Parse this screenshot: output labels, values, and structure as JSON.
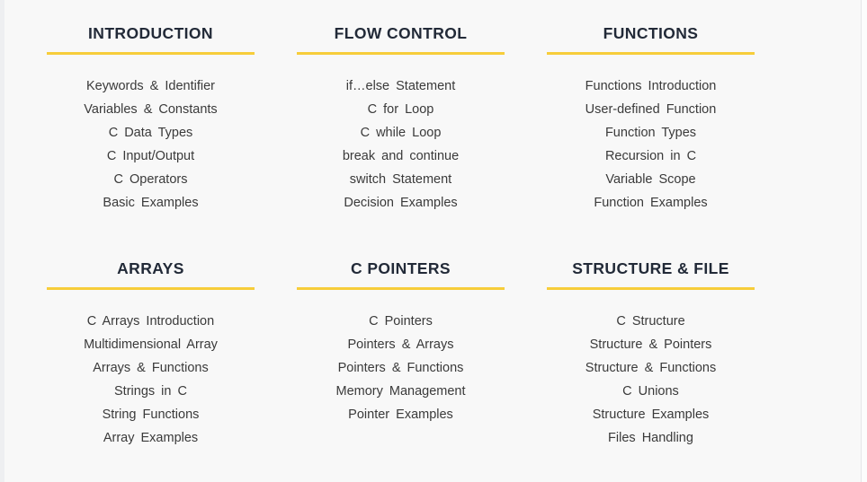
{
  "theme": {
    "page_background": "#f8f8f8",
    "accent_rule": "#f7cd3a",
    "heading_color": "#222a38",
    "link_color": "#3a3a3a"
  },
  "sections": [
    {
      "title": "INTRODUCTION",
      "links": [
        "Keywords & Identifier",
        "Variables & Constants",
        "C Data Types",
        "C Input/Output",
        "C Operators",
        "Basic Examples"
      ]
    },
    {
      "title": "FLOW CONTROL",
      "links": [
        "if…else Statement",
        "C for Loop",
        "C while Loop",
        "break and continue",
        "switch Statement",
        "Decision Examples"
      ]
    },
    {
      "title": "FUNCTIONS",
      "links": [
        "Functions Introduction",
        "User-defined Function",
        "Function Types",
        "Recursion in C",
        "Variable Scope",
        "Function Examples"
      ]
    },
    {
      "title": "ARRAYS",
      "links": [
        "C Arrays Introduction",
        "Multidimensional Array",
        "Arrays & Functions",
        "Strings in C",
        "String Functions",
        "Array Examples"
      ]
    },
    {
      "title": "C POINTERS",
      "links": [
        "C Pointers",
        "Pointers & Arrays",
        "Pointers & Functions",
        "Memory Management",
        "Pointer Examples"
      ]
    },
    {
      "title": "STRUCTURE & FILE",
      "links": [
        "C Structure",
        "Structure & Pointers",
        "Structure & Functions",
        "C Unions",
        "Structure Examples",
        "Files Handling"
      ]
    }
  ]
}
